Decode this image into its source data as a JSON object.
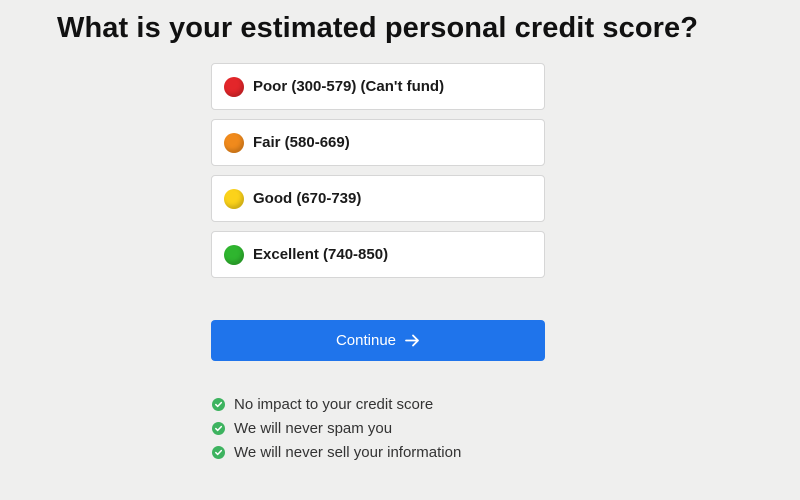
{
  "page": {
    "question": "What is your estimated personal credit score?"
  },
  "options": [
    {
      "label": "Poor (300-579) (Can't fund)",
      "color": "#e3262a",
      "icon": "red-circle-icon"
    },
    {
      "label": "Fair (580-669)",
      "color": "#f08a1c",
      "icon": "orange-circle-icon"
    },
    {
      "label": "Good (670-739)",
      "color": "#fbd21a",
      "icon": "yellow-circle-icon"
    },
    {
      "label": "Excellent (740-850)",
      "color": "#2fb52f",
      "icon": "green-circle-icon"
    }
  ],
  "continue_button": {
    "label": "Continue",
    "icon": "arrow-right-icon",
    "color": "#1f74eb"
  },
  "assurances": [
    {
      "text": "No impact to your credit score",
      "icon": "check-circle-icon"
    },
    {
      "text": "We will never spam you",
      "icon": "check-circle-icon"
    },
    {
      "text": "We will never sell your information",
      "icon": "check-circle-icon"
    }
  ],
  "colors": {
    "background": "#efefee",
    "check_green": "#3db35f"
  }
}
